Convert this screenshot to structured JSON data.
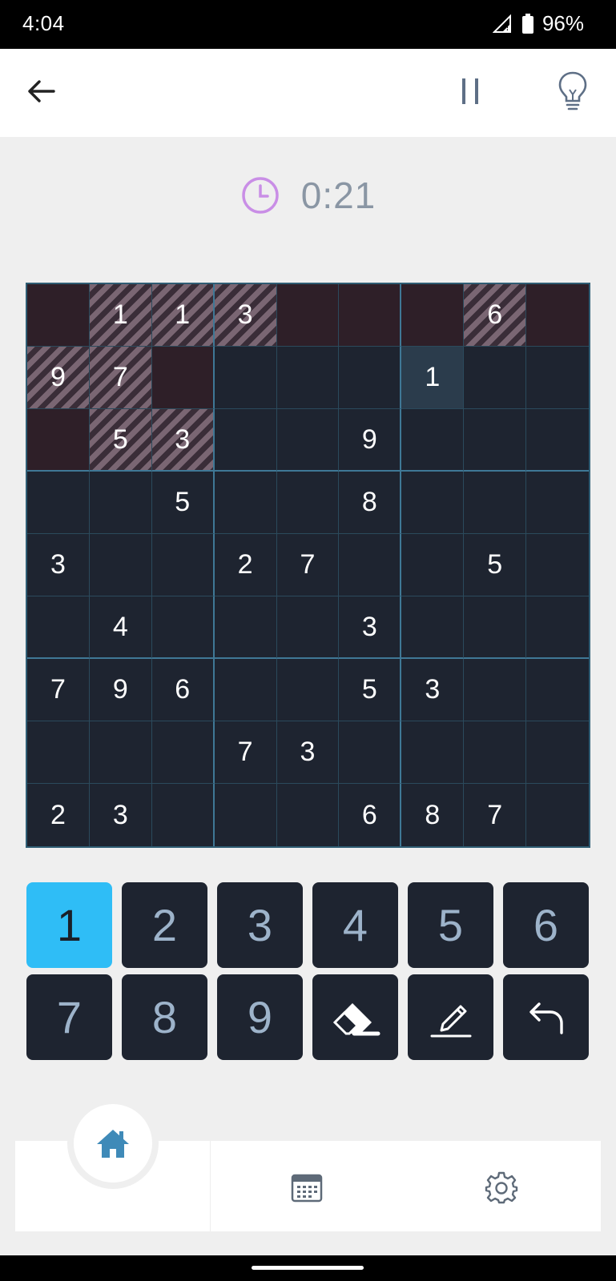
{
  "status_bar": {
    "time": "4:04",
    "battery": "96%"
  },
  "app_bar": {
    "back_icon": "arrow-left-icon",
    "pause_icon": "pause-icon",
    "hint_icon": "lightbulb-icon"
  },
  "timer": {
    "icon": "clock-icon",
    "value": "0:21",
    "icon_color": "#c98ee6"
  },
  "board": {
    "cells": [
      [
        "",
        "1",
        "1",
        "3",
        "",
        "",
        "",
        "6",
        ""
      ],
      [
        "9",
        "7",
        "",
        "",
        "",
        "",
        "1",
        "",
        ""
      ],
      [
        "",
        "5",
        "3",
        "",
        "",
        "9",
        "",
        "",
        ""
      ],
      [
        "",
        "",
        "5",
        "",
        "",
        "8",
        "",
        "",
        ""
      ],
      [
        "3",
        "",
        "",
        "2",
        "7",
        "",
        "",
        "5",
        ""
      ],
      [
        "",
        "4",
        "",
        "",
        "",
        "3",
        "",
        "",
        ""
      ],
      [
        "7",
        "9",
        "6",
        "",
        "",
        "5",
        "3",
        "",
        ""
      ],
      [
        "",
        "",
        "",
        "7",
        "3",
        "",
        "",
        "",
        ""
      ],
      [
        "2",
        "3",
        "",
        "",
        "",
        "6",
        "8",
        "7",
        ""
      ]
    ],
    "cell_states": [
      [
        "dark",
        "striped",
        "striped",
        "striped",
        "dark",
        "dark",
        "dark",
        "striped",
        "dark"
      ],
      [
        "striped",
        "striped",
        "dark",
        "",
        "",
        "",
        "selected",
        "",
        ""
      ],
      [
        "dark",
        "striped",
        "striped",
        "",
        "",
        "",
        "",
        "",
        ""
      ],
      [
        "",
        "",
        "",
        "",
        "",
        "",
        "",
        "",
        ""
      ],
      [
        "",
        "",
        "",
        "",
        "",
        "",
        "",
        "",
        ""
      ],
      [
        "",
        "",
        "",
        "",
        "",
        "",
        "",
        "",
        ""
      ],
      [
        "",
        "",
        "",
        "",
        "",
        "",
        "",
        "",
        ""
      ],
      [
        "",
        "",
        "",
        "",
        "",
        "",
        "",
        "",
        ""
      ],
      [
        "",
        "",
        "",
        "",
        "",
        "",
        "",
        "",
        ""
      ]
    ]
  },
  "number_pad": {
    "digits": [
      "1",
      "2",
      "3",
      "4",
      "5",
      "6",
      "7",
      "8",
      "9"
    ],
    "active_digit": "1",
    "tools": [
      "eraser-icon",
      "pencil-icon",
      "undo-icon"
    ]
  },
  "bottom_nav": {
    "items": [
      "home-icon",
      "calendar-icon",
      "settings-icon"
    ],
    "active": "home-icon",
    "active_color": "#3f8ab8"
  },
  "colors": {
    "accent": "#2fbdf6",
    "board_bg": "#1e2430",
    "conflict_dark": "#2e1f28",
    "selected_cell": "#2b3c4c"
  }
}
